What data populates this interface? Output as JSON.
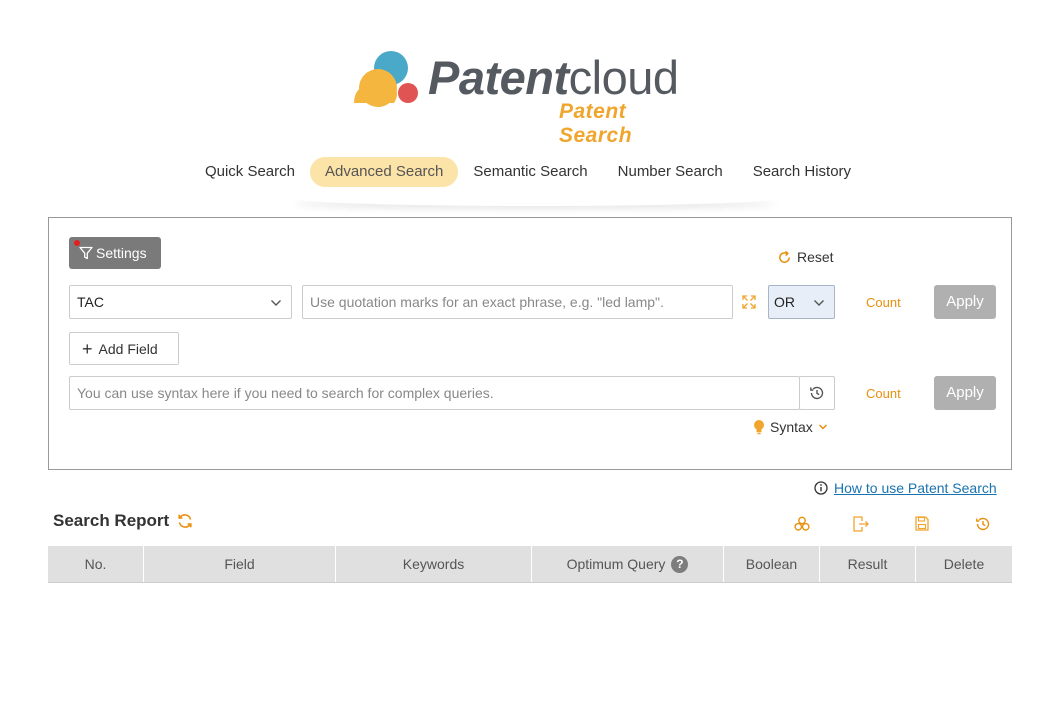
{
  "logo": {
    "brand_bold": "Patent",
    "brand_light": "cloud",
    "subtitle": "Patent Search",
    "colors": {
      "blue": "#4aa8c8",
      "yellow": "#f5b640",
      "red": "#e05454",
      "gray": "#555a60"
    }
  },
  "tabs": [
    {
      "label": "Quick Search",
      "active": false
    },
    {
      "label": "Advanced Search",
      "active": true
    },
    {
      "label": "Semantic Search",
      "active": false
    },
    {
      "label": "Number Search",
      "active": false
    },
    {
      "label": "Search History",
      "active": false
    }
  ],
  "panel": {
    "settings_label": "Settings",
    "reset_label": "Reset",
    "field_select_value": "TAC",
    "keyword_placeholder": "Use quotation marks for an exact phrase, e.g. \"led lamp\".",
    "operator_value": "OR",
    "count_label": "Count",
    "apply_label": "Apply",
    "add_field_label": "Add Field",
    "syntax_placeholder": "You can use syntax here if you need to search for complex queries.",
    "syntax_label": "Syntax"
  },
  "help": {
    "howto_label": "How to use Patent Search"
  },
  "report": {
    "title": "Search Report",
    "columns": [
      "No.",
      "Field",
      "Keywords",
      "Optimum Query",
      "Boolean",
      "Result",
      "Delete"
    ]
  },
  "colors": {
    "accent": "#e8900c",
    "tab_active_bg": "#fce3a8",
    "apply_bg": "#b0b0b0",
    "link": "#1a73b0"
  }
}
